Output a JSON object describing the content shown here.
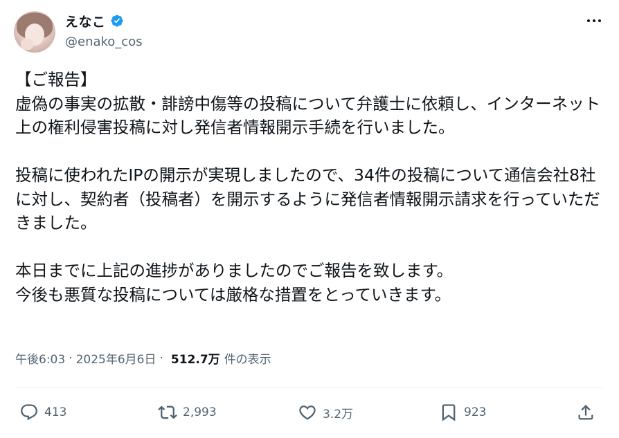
{
  "author": {
    "display_name": "えなこ",
    "handle": "@enako_cos",
    "verified": true
  },
  "tweet": {
    "text": "【ご報告】\n虚偽の事実の拡散・誹謗中傷等の投稿について弁護士に依頼し、インターネット上の権利侵害投稿に対し発信者情報開示手続を行いました。\n\n投稿に使われたIPの開示が実現しましたので、34件の投稿について通信会社8社に対し、契約者（投稿者）を開示するように発信者情報開示請求を行っていただきました。\n\n本日までに上記の進捗がありましたのでご報告を致します。\n今後も悪質な投稿については厳格な措置をとっていきます。"
  },
  "meta": {
    "time": "午後6:03",
    "separator": "·",
    "date": "2025年6月6日",
    "views_count": "512.7万",
    "views_label": "件の表示"
  },
  "actions": {
    "reply_count": "413",
    "repost_count": "2,993",
    "like_count": "3.2万",
    "bookmark_count": "923"
  },
  "colors": {
    "verified": "#1d9bf0",
    "secondary_text": "#536471",
    "primary_text": "#0f1419",
    "divider": "#eff3f4"
  },
  "icons": [
    "verified-badge-icon",
    "more-options-icon",
    "reply-icon",
    "repost-icon",
    "like-icon",
    "bookmark-icon",
    "share-icon"
  ]
}
